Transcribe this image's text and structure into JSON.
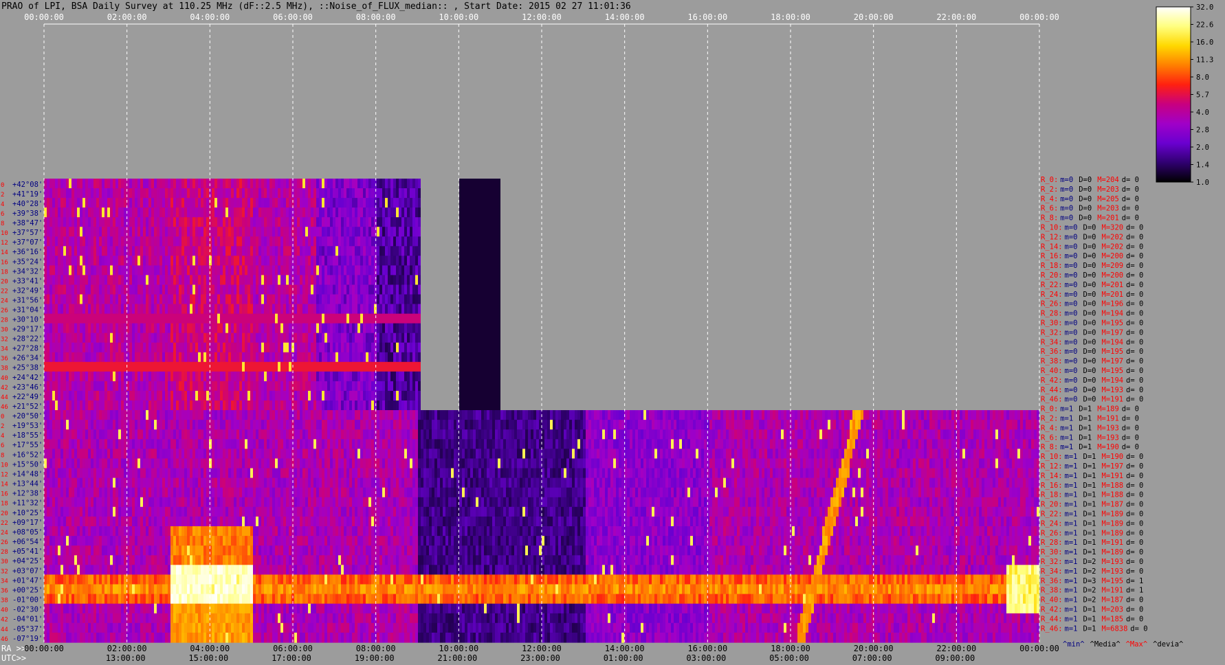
{
  "chart_data": {
    "type": "heatmap",
    "title": "PRAO of LPI, BSA Daily Survey at 110.25 MHz (dF::2.5 MHz), ::Noise_of_FLUX_median:: , Start Date: 2015 02 27 11:01:36",
    "x_top_ticks": [
      "00:00:00",
      "02:00:00",
      "04:00:00",
      "06:00:00",
      "08:00:00",
      "10:00:00",
      "12:00:00",
      "14:00:00",
      "16:00:00",
      "18:00:00",
      "20:00:00",
      "22:00:00",
      "00:00:00"
    ],
    "x_ra_ticks": [
      "00:00:00",
      "02:00:00",
      "04:00:00",
      "06:00:00",
      "08:00:00",
      "10:00:00",
      "12:00:00",
      "14:00:00",
      "16:00:00",
      "18:00:00",
      "20:00:00",
      "22:00:00",
      "00:00:00"
    ],
    "x_utc_ticks": [
      "13:00:00",
      "15:00:00",
      "17:00:00",
      "19:00:00",
      "21:00:00",
      "23:00:00",
      "01:00:00",
      "03:00:00",
      "05:00:00",
      "07:00:00",
      "09:00:00"
    ],
    "ra_label": "RA >>",
    "utc_label": "UTC>>",
    "y_ticks_upper": [
      "+42°08'",
      "+41°19'",
      "+40°28'",
      "+39°38'",
      "+38°47'",
      "+37°57'",
      "+37°07'",
      "+36°16'",
      "+35°24'",
      "+34°32'",
      "+33°41'",
      "+32°49'",
      "+31°56'",
      "+31°04'",
      "+30°10'",
      "+29°17'",
      "+28°22'",
      "+27°28'",
      "+26°34'",
      "+25°38'",
      "+24°42'",
      "+23°46'",
      "+22°49'",
      "+21°52'"
    ],
    "y_ticks_lower": [
      "+20°50'",
      "+19°53'",
      "+18°55'",
      "+17°55'",
      "+16°52'",
      "+15°50'",
      "+14°48'",
      "+13°44'",
      "+12°38'",
      "+11°32'",
      "+10°25'",
      "+09°17'",
      "+08°05'",
      "+06°54'",
      "+05°41'",
      "+04°25'",
      "+03°07'",
      "+01°47'",
      "+00°25'",
      "-01°00'",
      "-02°30'",
      "-04°01'",
      "-05°37'",
      "-07°19'"
    ],
    "row_numbers_upper": [
      "0",
      "2",
      "4",
      "6",
      "8",
      "10",
      "12",
      "14",
      "16",
      "18",
      "20",
      "22",
      "24",
      "26",
      "28",
      "30",
      "32",
      "34",
      "36",
      "38",
      "40",
      "42",
      "44",
      "46"
    ],
    "row_numbers_lower": [
      "0",
      "2",
      "4",
      "6",
      "8",
      "10",
      "12",
      "14",
      "16",
      "18",
      "20",
      "22",
      "24",
      "26",
      "28",
      "30",
      "32",
      "34",
      "36",
      "38",
      "40",
      "42",
      "44",
      "46"
    ],
    "colorbar": {
      "ticks": [
        "32.0",
        "22.6",
        "16.0",
        "11.3",
        "8.0",
        "5.7",
        "4.0",
        "2.8",
        "2.0",
        "1.4",
        "1.0"
      ],
      "scale": "log",
      "colormap": [
        "#ffffff",
        "#ffff80",
        "#ffd800",
        "#ff8000",
        "#ff2010",
        "#c80080",
        "#a000c8",
        "#6a00d0",
        "#300070",
        "#000000"
      ]
    },
    "beam_stats": [
      {
        "label": "R_0:",
        "m": "m=0",
        "D": "D=0",
        "M": "M=204",
        "d": "d= 0"
      },
      {
        "label": "R_2:",
        "m": "m=0",
        "D": "D=0",
        "M": "M=203",
        "d": "d= 0"
      },
      {
        "label": "R_4:",
        "m": "m=0",
        "D": "D=0",
        "M": "M=205",
        "d": "d= 0"
      },
      {
        "label": "R_6:",
        "m": "m=0",
        "D": "D=0",
        "M": "M=203",
        "d": "d= 0"
      },
      {
        "label": "R_8:",
        "m": "m=0",
        "D": "D=0",
        "M": "M=201",
        "d": "d= 0"
      },
      {
        "label": "R_10:",
        "m": "m=0",
        "D": "D=0",
        "M": "M=320",
        "d": "d= 0"
      },
      {
        "label": "R_12:",
        "m": "m=0",
        "D": "D=0",
        "M": "M=202",
        "d": "d= 0"
      },
      {
        "label": "R_14:",
        "m": "m=0",
        "D": "D=0",
        "M": "M=202",
        "d": "d= 0"
      },
      {
        "label": "R_16:",
        "m": "m=0",
        "D": "D=0",
        "M": "M=200",
        "d": "d= 0"
      },
      {
        "label": "R_18:",
        "m": "m=0",
        "D": "D=0",
        "M": "M=209",
        "d": "d= 0"
      },
      {
        "label": "R_20:",
        "m": "m=0",
        "D": "D=0",
        "M": "M=200",
        "d": "d= 0"
      },
      {
        "label": "R_22:",
        "m": "m=0",
        "D": "D=0",
        "M": "M=201",
        "d": "d= 0"
      },
      {
        "label": "R_24:",
        "m": "m=0",
        "D": "D=0",
        "M": "M=201",
        "d": "d= 0"
      },
      {
        "label": "R_26:",
        "m": "m=0",
        "D": "D=0",
        "M": "M=196",
        "d": "d= 0"
      },
      {
        "label": "R_28:",
        "m": "m=0",
        "D": "D=0",
        "M": "M=194",
        "d": "d= 0"
      },
      {
        "label": "R_30:",
        "m": "m=0",
        "D": "D=0",
        "M": "M=195",
        "d": "d= 0"
      },
      {
        "label": "R_32:",
        "m": "m=0",
        "D": "D=0",
        "M": "M=197",
        "d": "d= 0"
      },
      {
        "label": "R_34:",
        "m": "m=0",
        "D": "D=0",
        "M": "M=194",
        "d": "d= 0"
      },
      {
        "label": "R_36:",
        "m": "m=0",
        "D": "D=0",
        "M": "M=195",
        "d": "d= 0"
      },
      {
        "label": "R_38:",
        "m": "m=0",
        "D": "D=0",
        "M": "M=197",
        "d": "d= 0"
      },
      {
        "label": "R_40:",
        "m": "m=0",
        "D": "D=0",
        "M": "M=195",
        "d": "d= 0"
      },
      {
        "label": "R_42:",
        "m": "m=0",
        "D": "D=0",
        "M": "M=194",
        "d": "d= 0"
      },
      {
        "label": "R_44:",
        "m": "m=0",
        "D": "D=0",
        "M": "M=193",
        "d": "d= 0"
      },
      {
        "label": "R_46:",
        "m": "m=0",
        "D": "D=0",
        "M": "M=191",
        "d": "d= 0"
      },
      {
        "label": "R_0:",
        "m": "m=1",
        "D": "D=1",
        "M": "M=189",
        "d": "d= 0"
      },
      {
        "label": "R_2:",
        "m": "m=1",
        "D": "D=1",
        "M": "M=191",
        "d": "d= 0"
      },
      {
        "label": "R_4:",
        "m": "m=1",
        "D": "D=1",
        "M": "M=193",
        "d": "d= 0"
      },
      {
        "label": "R_6:",
        "m": "m=1",
        "D": "D=1",
        "M": "M=193",
        "d": "d= 0"
      },
      {
        "label": "R_8:",
        "m": "m=1",
        "D": "D=1",
        "M": "M=190",
        "d": "d= 0"
      },
      {
        "label": "R_10:",
        "m": "m=1",
        "D": "D=1",
        "M": "M=190",
        "d": "d= 0"
      },
      {
        "label": "R_12:",
        "m": "m=1",
        "D": "D=1",
        "M": "M=197",
        "d": "d= 0"
      },
      {
        "label": "R_14:",
        "m": "m=1",
        "D": "D=1",
        "M": "M=191",
        "d": "d= 0"
      },
      {
        "label": "R_16:",
        "m": "m=1",
        "D": "D=1",
        "M": "M=188",
        "d": "d= 0"
      },
      {
        "label": "R_18:",
        "m": "m=1",
        "D": "D=1",
        "M": "M=188",
        "d": "d= 0"
      },
      {
        "label": "R_20:",
        "m": "m=1",
        "D": "D=1",
        "M": "M=187",
        "d": "d= 0"
      },
      {
        "label": "R_22:",
        "m": "m=1",
        "D": "D=1",
        "M": "M=189",
        "d": "d= 0"
      },
      {
        "label": "R_24:",
        "m": "m=1",
        "D": "D=1",
        "M": "M=189",
        "d": "d= 0"
      },
      {
        "label": "R_26:",
        "m": "m=1",
        "D": "D=1",
        "M": "M=189",
        "d": "d= 0"
      },
      {
        "label": "R_28:",
        "m": "m=1",
        "D": "D=1",
        "M": "M=191",
        "d": "d= 0"
      },
      {
        "label": "R_30:",
        "m": "m=1",
        "D": "D=1",
        "M": "M=189",
        "d": "d= 0"
      },
      {
        "label": "R_32:",
        "m": "m=1",
        "D": "D=2",
        "M": "M=193",
        "d": "d= 0"
      },
      {
        "label": "R_34:",
        "m": "m=1",
        "D": "D=2",
        "M": "M=193",
        "d": "d= 0"
      },
      {
        "label": "R_36:",
        "m": "m=1",
        "D": "D=3",
        "M": "M=195",
        "d": "d= 1"
      },
      {
        "label": "R_38:",
        "m": "m=1",
        "D": "D=2",
        "M": "M=191",
        "d": "d= 1"
      },
      {
        "label": "R_40:",
        "m": "m=1",
        "D": "D=2",
        "M": "M=187",
        "d": "d= 0"
      },
      {
        "label": "R_42:",
        "m": "m=1",
        "D": "D=1",
        "M": "M=203",
        "d": "d= 0"
      },
      {
        "label": "R_44:",
        "m": "m=1",
        "D": "D=1",
        "M": "M=185",
        "d": "d= 0"
      },
      {
        "label": "R_46:",
        "m": "m=1",
        "D": "D=1",
        "M": "M=6838",
        "d": "d= 0"
      }
    ],
    "stats_legend": [
      {
        "text": "^min^",
        "color": "#000080"
      },
      {
        "text": "^Media^",
        "color": "#000000"
      },
      {
        "text": "^Max^",
        "color": "#ff0000"
      },
      {
        "text": "^devia^",
        "color": "#000000"
      }
    ],
    "colors": {
      "background": "#9c9c9c",
      "gap": "#9c9c9c",
      "label_red": "#ff0000",
      "label_navy": "#000080",
      "text": "#000000",
      "grid": "#ffffff"
    }
  }
}
